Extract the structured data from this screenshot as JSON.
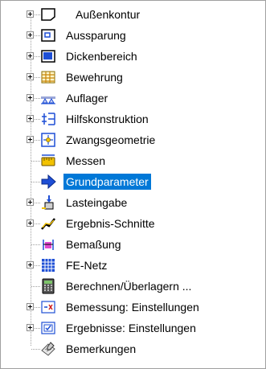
{
  "tree": {
    "items": [
      {
        "label": "Außenkontur",
        "icon": "outer-contour-icon",
        "expandable": true
      },
      {
        "label": "Aussparung",
        "icon": "recess-icon",
        "expandable": true
      },
      {
        "label": "Dickenbereich",
        "icon": "thickness-region-icon",
        "expandable": true
      },
      {
        "label": "Bewehrung",
        "icon": "reinforcement-icon",
        "expandable": true
      },
      {
        "label": "Auflager",
        "icon": "support-icon",
        "expandable": true
      },
      {
        "label": "Hilfskonstruktion",
        "icon": "auxiliary-construction-icon",
        "expandable": true
      },
      {
        "label": "Zwangsgeometrie",
        "icon": "constraint-geometry-icon",
        "expandable": true
      },
      {
        "label": "Messen",
        "icon": "measure-icon",
        "expandable": false
      },
      {
        "label": "Grundparameter",
        "icon": "basic-parameters-icon",
        "expandable": false,
        "selected": true
      },
      {
        "label": "Lasteingabe",
        "icon": "load-input-icon",
        "expandable": true
      },
      {
        "label": "Ergebnis-Schnitte",
        "icon": "result-sections-icon",
        "expandable": true
      },
      {
        "label": "Bemaßung",
        "icon": "dimensioning-icon",
        "expandable": false
      },
      {
        "label": "FE-Netz",
        "icon": "fe-mesh-icon",
        "expandable": true
      },
      {
        "label": "Berechnen/Überlagern ...",
        "icon": "calculator-icon",
        "expandable": false
      },
      {
        "label": "Bemessung: Einstellungen",
        "icon": "design-settings-icon",
        "expandable": true
      },
      {
        "label": "Ergebnisse: Einstellungen",
        "icon": "results-settings-icon",
        "expandable": true
      },
      {
        "label": "Bemerkungen",
        "icon": "remarks-icon",
        "expandable": false
      }
    ]
  },
  "colors": {
    "selection": "#0078d7",
    "tree_lines": "#a0a0a0",
    "icon_blue": "#1e4fd6",
    "icon_yellow": "#f2c200"
  }
}
